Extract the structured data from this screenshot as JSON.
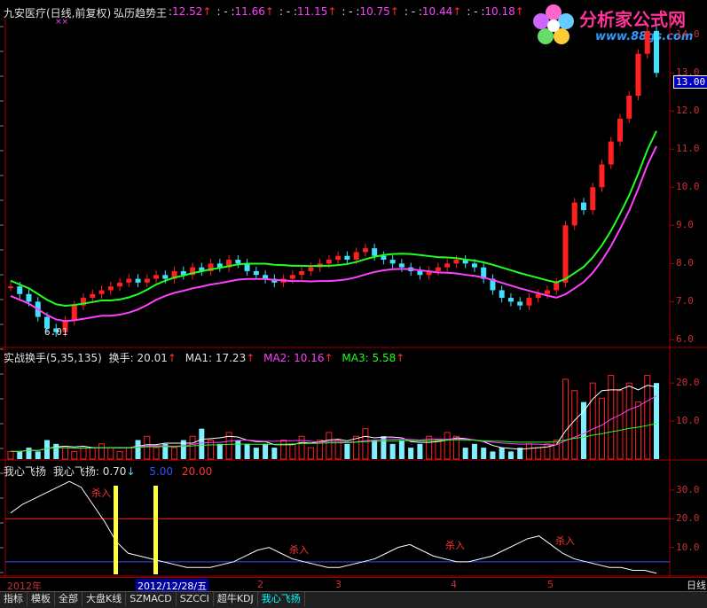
{
  "header": {
    "stock": "九安医疗(日线,前复权)",
    "indicator": "弘历趋势王",
    "values": [
      {
        "label": ":",
        "value": "12.52",
        "color": "#ff40ff"
      },
      {
        "label": ": - :",
        "value": "11.66",
        "color": "#ff40ff"
      },
      {
        "label": ": - :",
        "value": "11.15",
        "color": "#ff40ff"
      },
      {
        "label": ": - :",
        "value": "10.75",
        "color": "#ff40ff"
      },
      {
        "label": ": - :",
        "value": "10.44",
        "color": "#ff40ff"
      },
      {
        "label": ": - :",
        "value": "10.18",
        "color": "#ff40ff"
      }
    ],
    "marks": "××"
  },
  "logo": {
    "title": "分析家公式网",
    "url": "www.88gs.com"
  },
  "price_panel": {
    "low_label": "6.01",
    "current_price": "13.00",
    "ticks": [
      "14.0",
      "13.0",
      "12.0",
      "11.0",
      "10.0",
      "9.0",
      "8.0",
      "7.0",
      "6.0"
    ]
  },
  "volume_panel": {
    "title": "实战换手(5,35,135)",
    "turnover_label": "换手:",
    "turnover_value": "20.01",
    "ma1_label": "MA1:",
    "ma1_value": "17.23",
    "ma2_label": "MA2:",
    "ma2_value": "10.16",
    "ma3_label": "MA3:",
    "ma3_value": "5.58",
    "ticks": [
      "20.0",
      "10.0"
    ]
  },
  "osc_panel": {
    "title": "我心飞扬",
    "name_label": "我心飞扬:",
    "value": "0.70",
    "line1": "5.00",
    "line2": "20.00",
    "ticks": [
      "30.0",
      "20.0",
      "10.0"
    ],
    "buy_labels": [
      "杀入",
      "杀入",
      "杀入",
      "杀入"
    ]
  },
  "xaxis": {
    "labels": [
      "2012年",
      "2012/12/28/五",
      "2",
      "3",
      "4",
      "5"
    ],
    "right_label": "日线"
  },
  "tabs": [
    "指标",
    "模板",
    "全部",
    "大盘K线",
    "SZMACD",
    "SZCCI",
    "超牛KDJ",
    "我心飞扬"
  ],
  "colors": {
    "up": "#ff2020",
    "down": "#40e0ff",
    "green_band": "#20ff20",
    "ma_magenta": "#ff40ff",
    "grid_red": "#a00000"
  },
  "chart_data": [
    {
      "type": "candlestick",
      "title": "九安医疗(日线,前复权)",
      "ylim": [
        5.8,
        14.4
      ],
      "close": [
        7.4,
        7.2,
        7.0,
        6.6,
        6.3,
        6.2,
        6.5,
        6.9,
        7.1,
        7.2,
        7.3,
        7.4,
        7.5,
        7.6,
        7.5,
        7.6,
        7.7,
        7.6,
        7.8,
        7.7,
        7.9,
        7.8,
        8.0,
        7.9,
        8.1,
        8.0,
        7.8,
        7.7,
        7.6,
        7.5,
        7.6,
        7.7,
        7.8,
        7.9,
        8.0,
        8.1,
        8.2,
        8.1,
        8.3,
        8.4,
        8.2,
        8.1,
        8.0,
        7.9,
        7.8,
        7.7,
        7.8,
        7.9,
        8.0,
        8.1,
        8.0,
        7.9,
        7.6,
        7.3,
        7.1,
        7.0,
        6.9,
        7.1,
        7.2,
        7.3,
        7.5,
        9.0,
        9.6,
        9.4,
        10.0,
        10.6,
        11.2,
        11.8,
        12.4,
        13.5,
        14.1,
        13.0
      ]
    },
    {
      "type": "bar",
      "title": "实战换手(5,35,135)",
      "ylim": [
        0,
        24
      ],
      "values": [
        2,
        2,
        3,
        2,
        5,
        4,
        3,
        2,
        3,
        3,
        4,
        3,
        2,
        3,
        5,
        6,
        3,
        4,
        3,
        5,
        6,
        8,
        5,
        4,
        7,
        5,
        4,
        3,
        4,
        3,
        5,
        4,
        6,
        3,
        5,
        7,
        5,
        4,
        6,
        8,
        5,
        6,
        4,
        5,
        3,
        4,
        6,
        5,
        7,
        6,
        3,
        4,
        3,
        2,
        3,
        2,
        3,
        4,
        3,
        4,
        5,
        21,
        18,
        15,
        20,
        16,
        22,
        18,
        20,
        15,
        22,
        20
      ]
    },
    {
      "type": "line",
      "title": "我心飞扬",
      "ylim": [
        0,
        34
      ],
      "values": [
        22,
        25,
        27,
        29,
        31,
        33,
        31,
        25,
        19,
        12,
        8,
        7,
        6,
        5,
        4,
        3,
        3,
        3,
        4,
        5,
        7,
        9,
        10,
        8,
        6,
        5,
        4,
        3,
        3,
        4,
        5,
        6,
        8,
        10,
        11,
        9,
        7,
        6,
        5,
        5,
        6,
        7,
        9,
        11,
        13,
        14,
        11,
        8,
        6,
        5,
        4,
        3,
        3,
        2,
        2,
        1
      ],
      "lines": [
        5.0,
        20.0
      ]
    }
  ]
}
